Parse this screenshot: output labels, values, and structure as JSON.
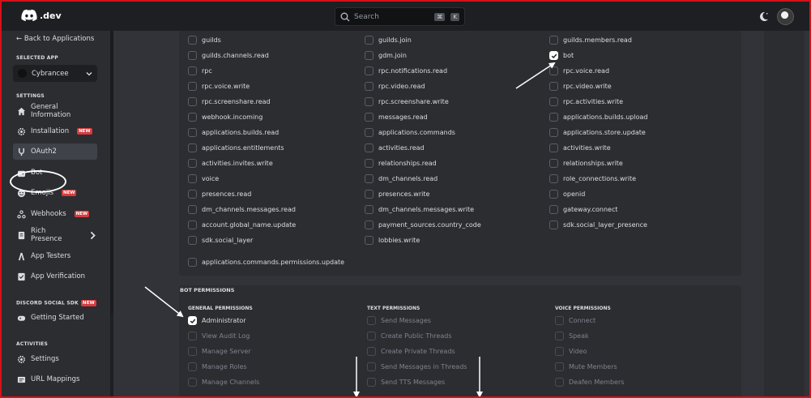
{
  "topbar": {
    "logo_text": ".dev",
    "search_placeholder": "Search",
    "shortcut_mod": "⌘",
    "shortcut_key": "K"
  },
  "sidebar": {
    "back_label": "Back to Applications",
    "selected_app_heading": "SELECTED APP",
    "app_name": "Cybrancee",
    "settings_heading": "SETTINGS",
    "items": [
      {
        "label": "General Information",
        "new": ""
      },
      {
        "label": "Installation",
        "new": "NEW"
      },
      {
        "label": "OAuth2",
        "new": ""
      },
      {
        "label": "Bot",
        "new": ""
      },
      {
        "label": "Emojis",
        "new": "NEW"
      },
      {
        "label": "Webhooks",
        "new": "NEW"
      },
      {
        "label": "Rich Presence",
        "new": ""
      },
      {
        "label": "App Testers",
        "new": ""
      },
      {
        "label": "App Verification",
        "new": ""
      }
    ],
    "sdk_heading": "DISCORD SOCIAL SDK",
    "sdk_new": "NEW",
    "sdk_item": "Getting Started",
    "activities_heading": "ACTIVITIES",
    "activity_items": [
      "Settings",
      "URL Mappings"
    ]
  },
  "scopes": [
    [
      "guilds",
      "guilds.join",
      "guilds.members.read"
    ],
    [
      "guilds.channels.read",
      "gdm.join",
      "bot"
    ],
    [
      "rpc",
      "rpc.notifications.read",
      "rpc.voice.read"
    ],
    [
      "rpc.voice.write",
      "rpc.video.read",
      "rpc.video.write"
    ],
    [
      "rpc.screenshare.read",
      "rpc.screenshare.write",
      "rpc.activities.write"
    ],
    [
      "webhook.incoming",
      "messages.read",
      "applications.builds.upload"
    ],
    [
      "applications.builds.read",
      "applications.commands",
      "applications.store.update"
    ],
    [
      "applications.entitlements",
      "activities.read",
      "activities.write"
    ],
    [
      "activities.invites.write",
      "relationships.read",
      "relationships.write"
    ],
    [
      "voice",
      "dm_channels.read",
      "role_connections.write"
    ],
    [
      "presences.read",
      "presences.write",
      "openid"
    ],
    [
      "dm_channels.messages.read",
      "dm_channels.messages.write",
      "gateway.connect"
    ],
    [
      "account.global_name.update",
      "payment_sources.country_code",
      "sdk.social_layer_presence"
    ],
    [
      "sdk.social_layer",
      "lobbies.write",
      ""
    ]
  ],
  "scope_extra": "applications.commands.permissions.update",
  "checked_scope": "bot",
  "bot_permissions": {
    "title": "BOT PERMISSIONS",
    "general_heading": "GENERAL PERMISSIONS",
    "text_heading": "TEXT PERMISSIONS",
    "voice_heading": "VOICE PERMISSIONS",
    "general": [
      "Administrator",
      "View Audit Log",
      "Manage Server",
      "Manage Roles",
      "Manage Channels"
    ],
    "text": [
      "Send Messages",
      "Create Public Threads",
      "Create Private Threads",
      "Send Messages in Threads",
      "Send TTS Messages"
    ],
    "voice": [
      "Connect",
      "Speak",
      "Video",
      "Mute Members",
      "Deafen Members"
    ]
  }
}
